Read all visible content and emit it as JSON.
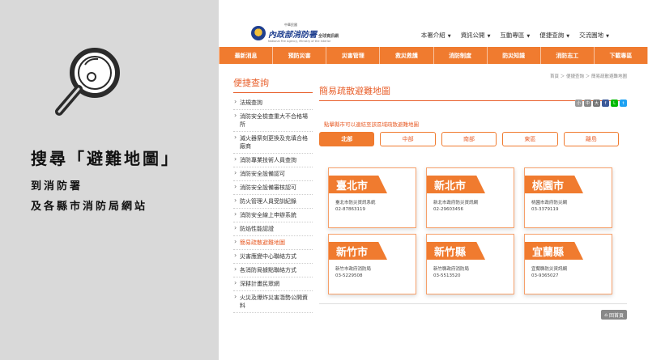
{
  "caption": {
    "line1": "搜尋「避難地圖」",
    "line2": "到消防署",
    "line3": "及各縣市消防局網站"
  },
  "header": {
    "logo_small": "中華民國",
    "logo_title": "內政部消防署",
    "logo_tag": "全球資訊網",
    "logo_en": "National Fire Agency, Ministry of the Interior",
    "topnav": [
      {
        "label": "本署介紹"
      },
      {
        "label": "資訊公開"
      },
      {
        "label": "互動專區"
      },
      {
        "label": "便捷查詢"
      },
      {
        "label": "交流園地"
      }
    ]
  },
  "main_nav": [
    "最新消息",
    "預防災害",
    "災害管理",
    "救災救護",
    "消防制度",
    "防災知識",
    "消防志工",
    "下載專區"
  ],
  "sidebar": {
    "title": "便捷查詢",
    "items": [
      "法規查詢",
      "消防安全檢查重大不合格場所",
      "滅火器祭刻更換及充填合格廠商",
      "消防專業技術人員查詢",
      "消防安全設備認可",
      "消防安全設備審核認可",
      "防火管理人員受訓紀錄",
      "消防安全線上申辦系統",
      "防焰性能認證",
      "簡易疏散避難地圖",
      "災害應變中心聯絡方式",
      "各消防局據點聯絡方式",
      "深耕計畫民眾網",
      "火災及爆炸災害潛勢公開資料"
    ],
    "active_index": 9
  },
  "main": {
    "breadcrumb": "首頁 ＞ 便捷查詢 ＞ 簡易疏散避難地圖",
    "title": "簡易疏散避難地圖",
    "share_icons": [
      "小",
      "中",
      "大",
      "f",
      "L",
      "t"
    ],
    "notice": "點擊縣市可以連結至該區域疏散避難地圖",
    "tabs": [
      "北部",
      "中部",
      "南部",
      "東區",
      "離島"
    ],
    "active_tab": 0,
    "cards": [
      {
        "title": "臺北市",
        "name": "臺北市防災資訊系統",
        "phone": "02-87863119"
      },
      {
        "title": "新北市",
        "name": "新北市政府防災資訊網",
        "phone": "02-29603456"
      },
      {
        "title": "桃園市",
        "name": "桃園市政府防災網",
        "phone": "03-3379119"
      },
      {
        "title": "新竹市",
        "name": "新竹市政府消防局",
        "phone": "03-5229508"
      },
      {
        "title": "新竹縣",
        "name": "新竹縣政府消防局",
        "phone": "03-5513520"
      },
      {
        "title": "宜蘭縣",
        "name": "宜蘭縣防災資訊網",
        "phone": "03-9365027"
      }
    ],
    "back_label": "回首頁"
  },
  "colors": {
    "accent": "#f07b2f",
    "title_orange": "#e8602c",
    "left_panel": "#d9d9d9",
    "share_colors": [
      "#999999",
      "#888888",
      "#777777",
      "#3b5998",
      "#00b900",
      "#1da1f2"
    ]
  }
}
